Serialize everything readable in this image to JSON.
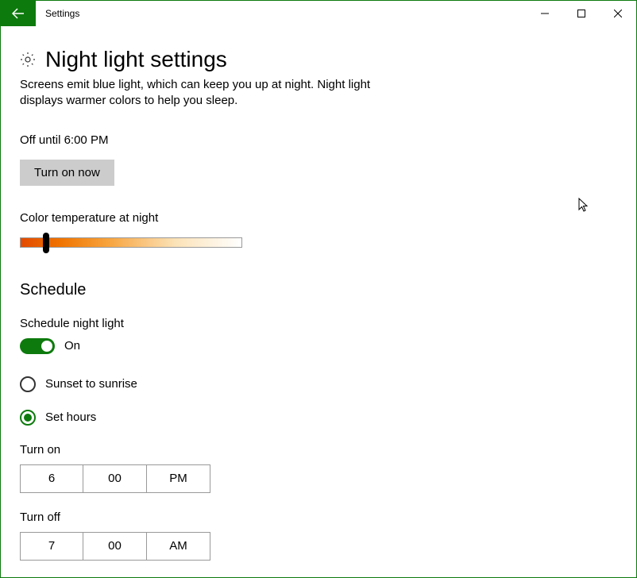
{
  "window": {
    "title": "Settings"
  },
  "page": {
    "title": "Night light settings",
    "description": "Screens emit blue light, which can keep you up at night. Night light displays warmer colors to help you sleep."
  },
  "status": "Off until 6:00 PM",
  "turn_on_now_label": "Turn on now",
  "color_temp_label": "Color temperature at night",
  "color_temp_value_percent": 12,
  "schedule": {
    "section_title": "Schedule",
    "toggle_label": "Schedule night light",
    "toggle_state": "On",
    "options": {
      "sunset": "Sunset to sunrise",
      "set_hours": "Set hours"
    },
    "selected_option": "set_hours",
    "turn_on": {
      "label": "Turn on",
      "hour": "6",
      "minute": "00",
      "ampm": "PM"
    },
    "turn_off": {
      "label": "Turn off",
      "hour": "7",
      "minute": "00",
      "ampm": "AM"
    }
  }
}
